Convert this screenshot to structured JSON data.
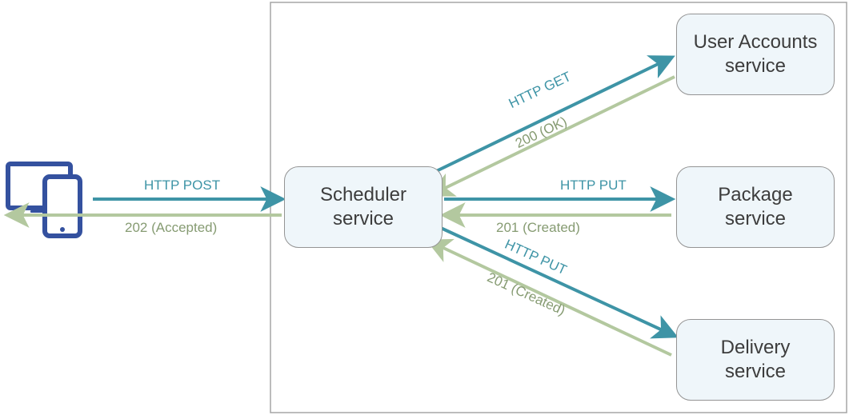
{
  "nodes": {
    "scheduler": "Scheduler service",
    "user_accounts": "User Accounts service",
    "package": "Package service",
    "delivery": "Delivery service"
  },
  "edges": {
    "client_to_scheduler": {
      "request": "HTTP POST",
      "response": "202 (Accepted)"
    },
    "scheduler_to_user_accounts": {
      "request": "HTTP GET",
      "response": "200 (OK)"
    },
    "scheduler_to_package": {
      "request": "HTTP PUT",
      "response": "201 (Created)"
    },
    "scheduler_to_delivery": {
      "request": "HTTP PUT",
      "response": "201 (Created)"
    }
  },
  "colors": {
    "request_stroke": "#3e94a6",
    "response_stroke": "#b3c89f",
    "node_fill": "#eff6fa",
    "node_stroke": "#949494",
    "frame_stroke": "#a5a5a5",
    "device_stroke": "#34519f"
  }
}
